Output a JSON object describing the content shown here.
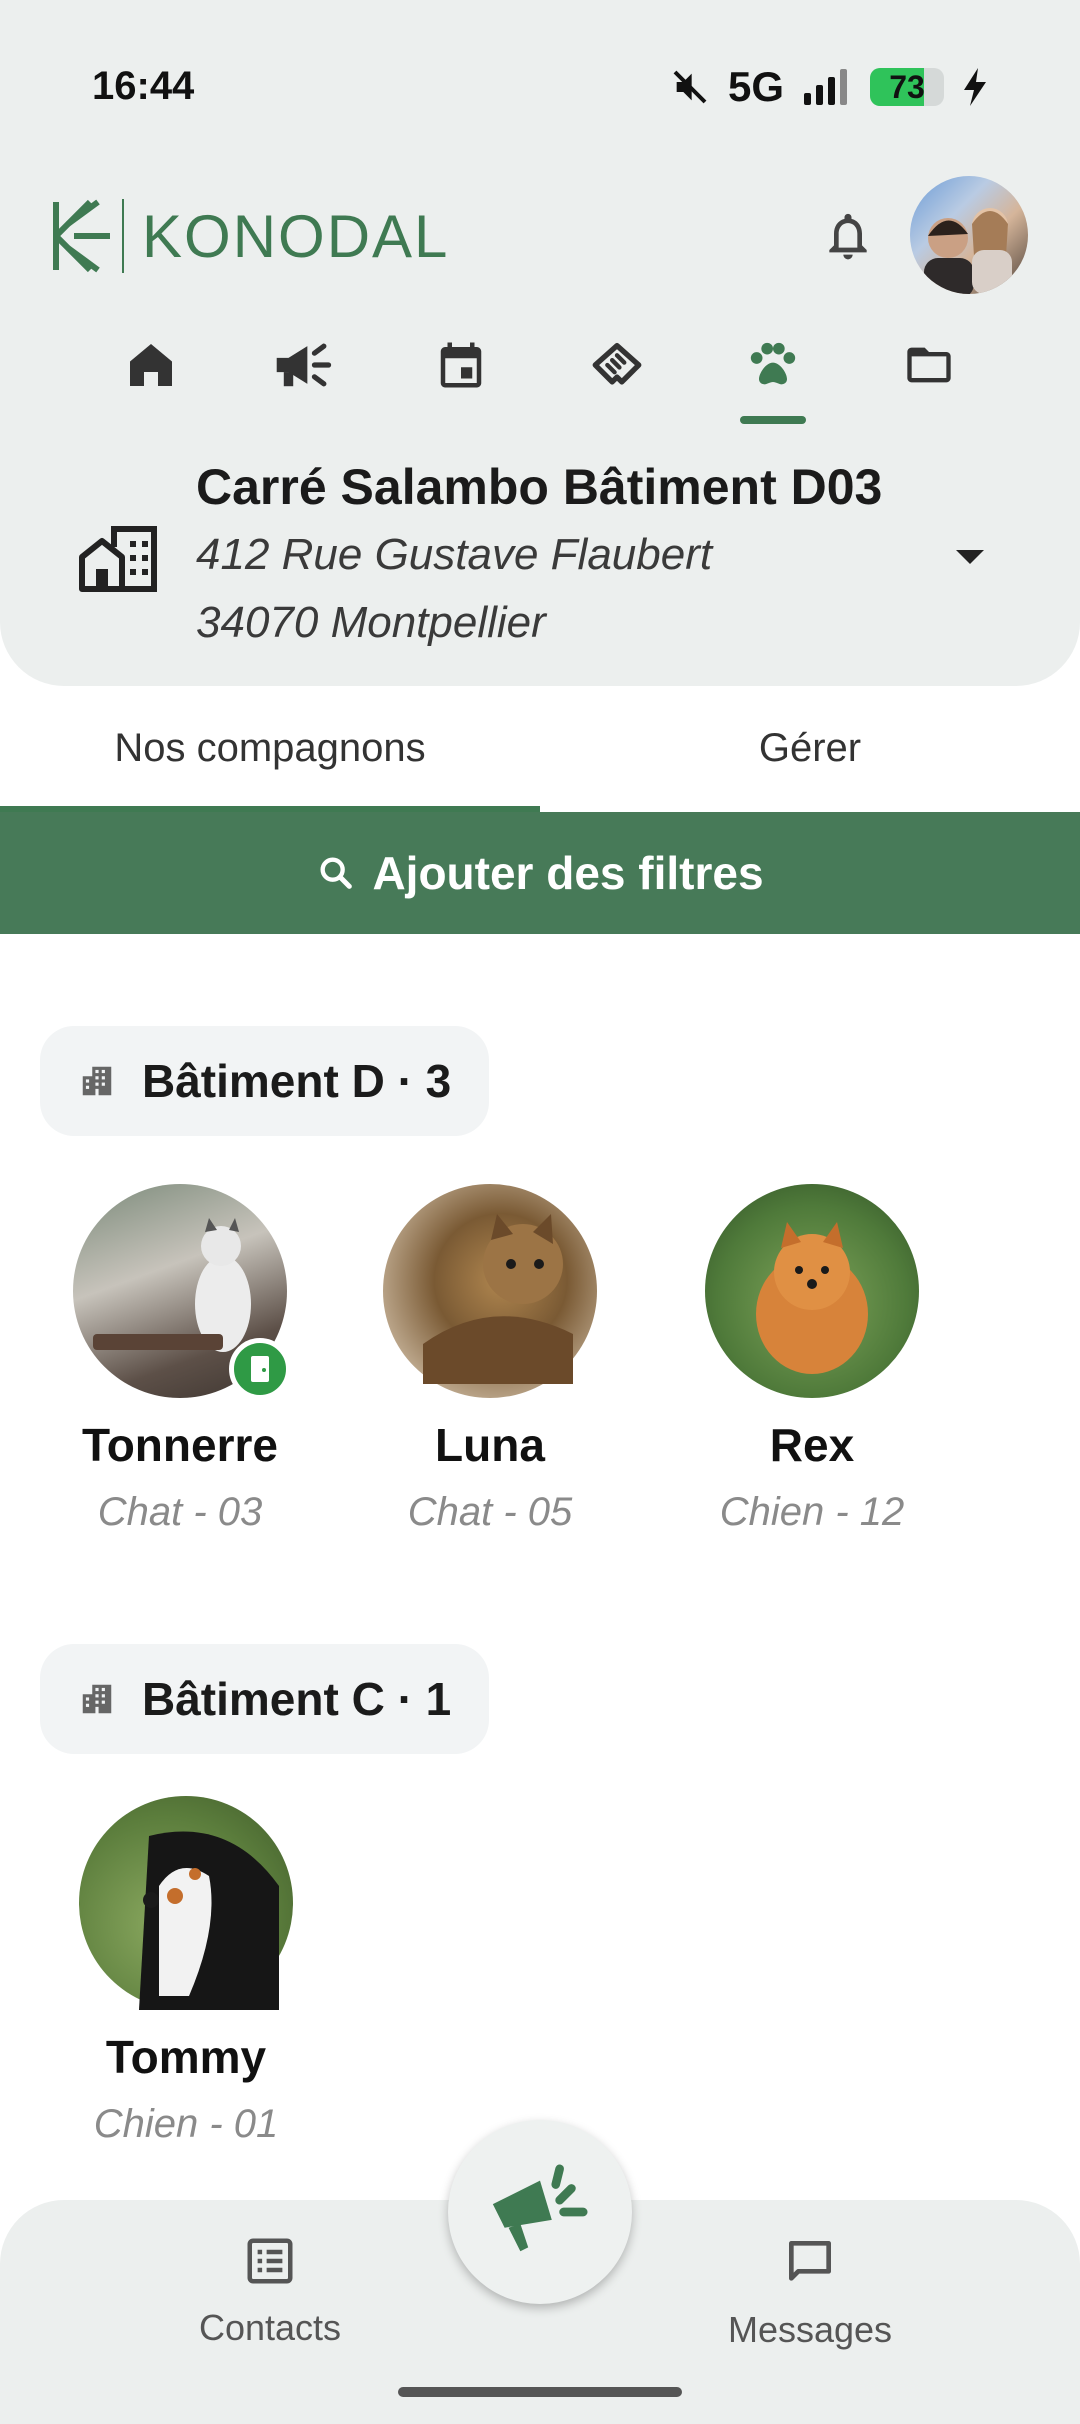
{
  "status_bar": {
    "time": "16:44",
    "network": "5G",
    "battery_percent": 73
  },
  "header": {
    "app_name": "KONODAL"
  },
  "nav_tabs": [
    {
      "icon": "home-icon",
      "active": false
    },
    {
      "icon": "megaphone-icon",
      "active": false
    },
    {
      "icon": "calendar-icon",
      "active": false
    },
    {
      "icon": "handshake-icon",
      "active": false
    },
    {
      "icon": "paw-icon",
      "active": true
    },
    {
      "icon": "folder-icon",
      "active": false
    }
  ],
  "residence": {
    "name": "Carré Salambo Bâtiment D03",
    "street": "412 Rue Gustave Flaubert",
    "city": "34070 Montpellier"
  },
  "segments": {
    "companions": "Nos compagnons",
    "manage": "Gérer"
  },
  "filter_button": "Ajouter des filtres",
  "groups": [
    {
      "label": "Bâtiment D · 3",
      "pets": [
        {
          "name": "Tonnerre",
          "detail": "Chat - 03"
        },
        {
          "name": "Luna",
          "detail": "Chat - 05"
        },
        {
          "name": "Rex",
          "detail": "Chien - 12"
        }
      ]
    },
    {
      "label": "Bâtiment C · 1",
      "pets": [
        {
          "name": "Tommy",
          "detail": "Chien - 01"
        }
      ]
    }
  ],
  "bottom_nav": {
    "contacts": "Contacts",
    "messages": "Messages"
  },
  "colors": {
    "brand_green": "#3f7a52",
    "filter_green": "#477a58",
    "panel_bg": "#ecefee"
  }
}
